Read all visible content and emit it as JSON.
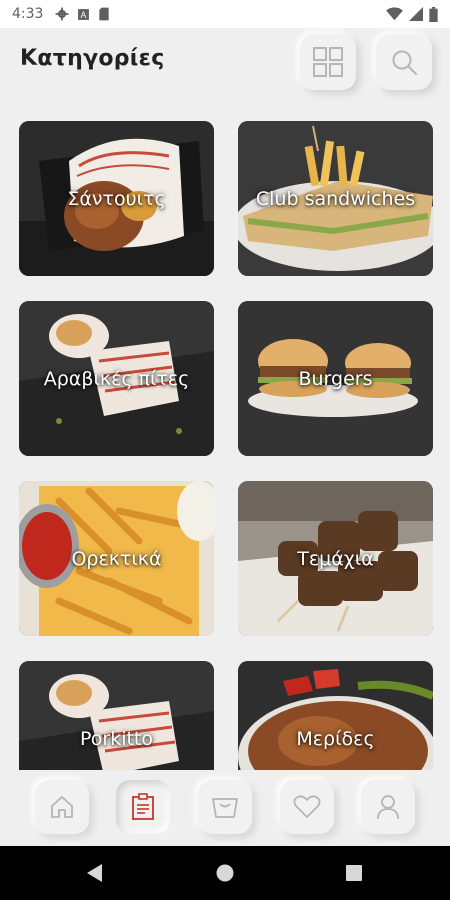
{
  "status_bar": {
    "time": "4:33",
    "icons": [
      "settings-icon",
      "font-icon",
      "sd-card-icon",
      "wifi-icon",
      "signal-icon",
      "battery-icon"
    ]
  },
  "header": {
    "title": "Κατηγορίες",
    "buttons": [
      "grid-view-icon",
      "search-icon"
    ]
  },
  "categories": [
    {
      "label": "Σάντουιτς",
      "theme": "wrap"
    },
    {
      "label": "Club sandwiches",
      "theme": "club"
    },
    {
      "label": "Αραβικές πίτες",
      "theme": "wrap"
    },
    {
      "label": "Burgers",
      "theme": "burger"
    },
    {
      "label": "Ορεκτικά",
      "theme": "fries"
    },
    {
      "label": "Τεμάχια",
      "theme": "skewer"
    },
    {
      "label": "Porkitto",
      "theme": "wrap"
    },
    {
      "label": "Μερίδες",
      "theme": "platter"
    }
  ],
  "bottom_nav": {
    "items": [
      {
        "icon": "home-icon",
        "active": false
      },
      {
        "icon": "menu-list-icon",
        "active": true
      },
      {
        "icon": "basket-icon",
        "active": false
      },
      {
        "icon": "heart-icon",
        "active": false
      },
      {
        "icon": "user-icon",
        "active": false
      }
    ]
  },
  "colors": {
    "background": "#efefef",
    "accent": "#c0392b",
    "icon_gray": "#b5b5b5"
  }
}
